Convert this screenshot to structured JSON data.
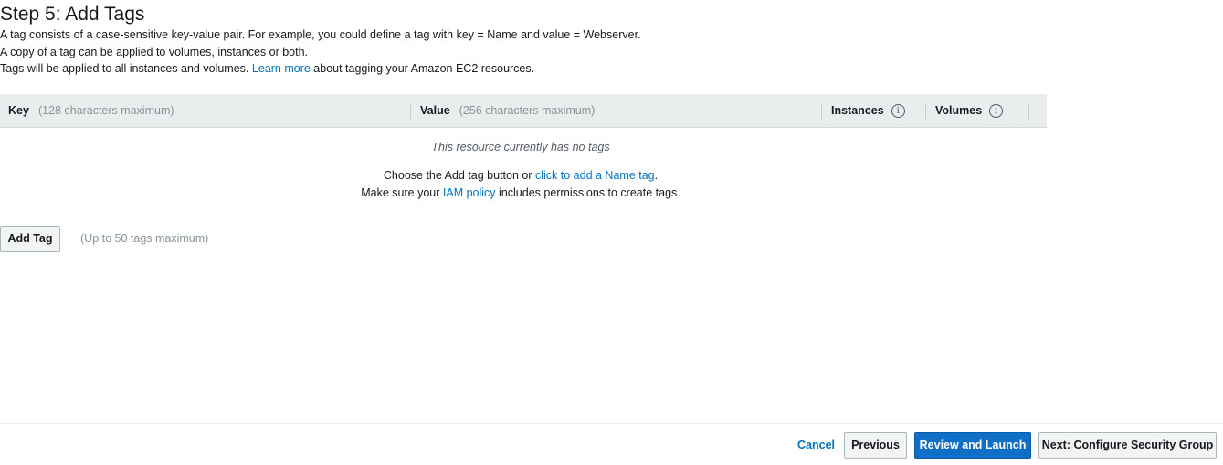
{
  "header": {
    "title": "Step 5: Add Tags",
    "line1": "A tag consists of a case-sensitive key-value pair. For example, you could define a tag with key = Name and value = Webserver.",
    "line2": "A copy of a tag can be applied to volumes, instances or both.",
    "line3_pre": "Tags will be applied to all instances and volumes.",
    "line3_link": "Learn more",
    "line3_post": "about tagging your Amazon EC2 resources."
  },
  "table": {
    "key_label": "Key",
    "key_hint": "(128 characters maximum)",
    "value_label": "Value",
    "value_hint": "(256 characters maximum)",
    "instances_label": "Instances",
    "volumes_label": "Volumes",
    "info_glyph": "i"
  },
  "empty": {
    "message": "This resource currently has no tags",
    "choose_pre": "Choose the Add tag button or",
    "choose_link": "click to add a Name tag",
    "choose_post": ".",
    "policy_pre": "Make sure your",
    "policy_link": "IAM policy",
    "policy_post": "includes permissions to create tags."
  },
  "add_tag": {
    "button": "Add Tag",
    "hint": "(Up to 50 tags maximum)"
  },
  "footer": {
    "cancel": "Cancel",
    "previous": "Previous",
    "review": "Review and Launch",
    "next": "Next: Configure Security Group"
  },
  "colors": {
    "link": "#0073bb",
    "primary": "#0f6fc6",
    "header_bg": "#eaeded"
  }
}
